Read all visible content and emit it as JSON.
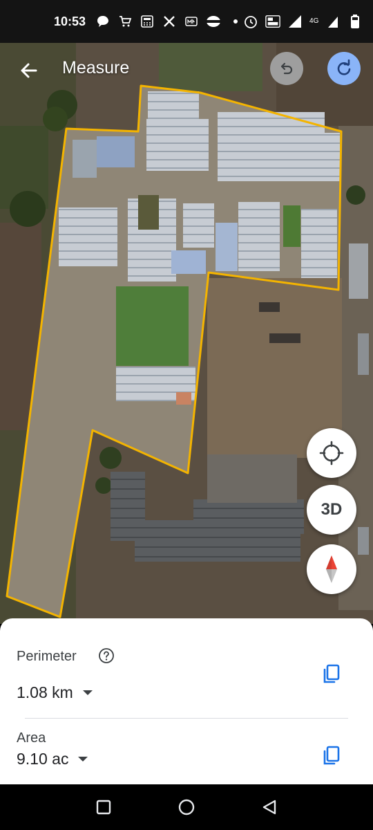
{
  "status_bar": {
    "time": "10:53",
    "network_label": "4G",
    "icons": [
      "chat-icon",
      "cart-icon",
      "calculator-icon",
      "x-icon",
      "m-icon",
      "vpn-icon",
      "dot-icon",
      "alarm-icon",
      "volte-icon",
      "signal-icon",
      "battery-icon"
    ]
  },
  "header": {
    "title": "Measure",
    "back_icon": "arrow-back-icon",
    "undo_icon": "undo-icon",
    "redo_icon": "redo-icon"
  },
  "map_controls": {
    "locate_icon": "my-location-icon",
    "three_d_label": "3D",
    "compass_icon": "compass-icon"
  },
  "measurements": {
    "perimeter_label": "Perimeter",
    "perimeter_value": "1.08 km",
    "area_label": "Area",
    "area_value": "9.10 ac"
  },
  "colors": {
    "outline": "#f4b400",
    "accent": "#1a73e8",
    "redo_bg": "#8ab4f8",
    "undo_bg": "#9e9e9e"
  }
}
